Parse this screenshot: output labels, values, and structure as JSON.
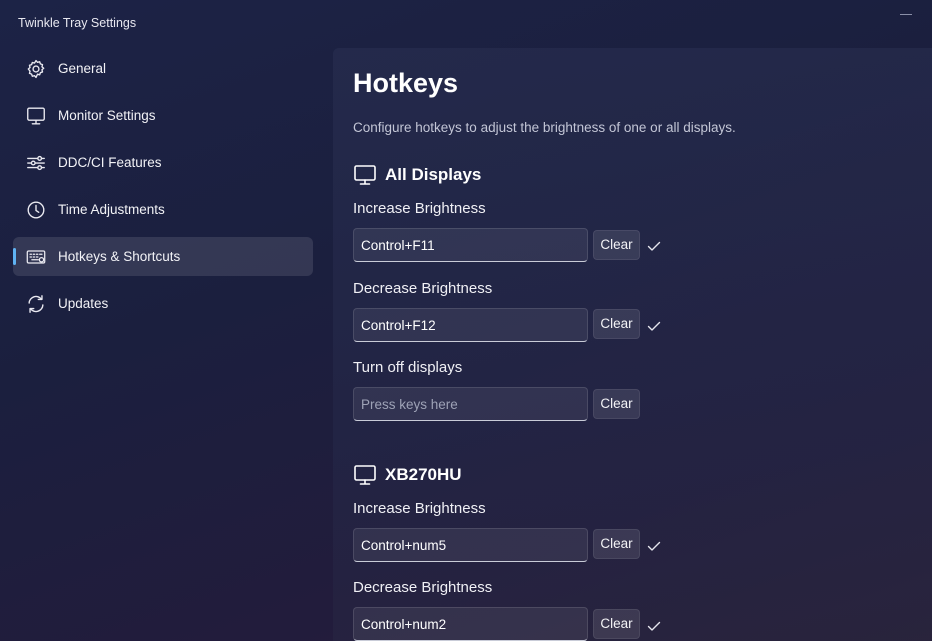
{
  "window": {
    "title": "Twinkle Tray Settings"
  },
  "sidebar": {
    "items": [
      {
        "label": "General",
        "icon": "gear-icon"
      },
      {
        "label": "Monitor Settings",
        "icon": "monitor-icon"
      },
      {
        "label": "DDC/CI Features",
        "icon": "sliders-icon"
      },
      {
        "label": "Time Adjustments",
        "icon": "clock-icon"
      },
      {
        "label": "Hotkeys & Shortcuts",
        "icon": "keyboard-icon",
        "active": true
      },
      {
        "label": "Updates",
        "icon": "refresh-icon"
      }
    ]
  },
  "page": {
    "title": "Hotkeys",
    "description": "Configure hotkeys to adjust the brightness of one or all displays."
  },
  "sections": [
    {
      "title": "All Displays",
      "icon": "monitor-icon",
      "hotkeys": [
        {
          "label": "Increase Brightness",
          "value": "Control+F11",
          "placeholder": "Press keys here",
          "clear": "Clear",
          "saved": true
        },
        {
          "label": "Decrease Brightness",
          "value": "Control+F12",
          "placeholder": "Press keys here",
          "clear": "Clear",
          "saved": true
        },
        {
          "label": "Turn off displays",
          "value": "",
          "placeholder": "Press keys here",
          "clear": "Clear",
          "saved": false
        }
      ]
    },
    {
      "title": "XB270HU",
      "icon": "monitor-icon",
      "hotkeys": [
        {
          "label": "Increase Brightness",
          "value": "Control+num5",
          "placeholder": "Press keys here",
          "clear": "Clear",
          "saved": true
        },
        {
          "label": "Decrease Brightness",
          "value": "Control+num2",
          "placeholder": "Press keys here",
          "clear": "Clear",
          "saved": true
        }
      ]
    }
  ],
  "colors": {
    "accent": "#5fb2f2",
    "background": "#1c2346"
  }
}
